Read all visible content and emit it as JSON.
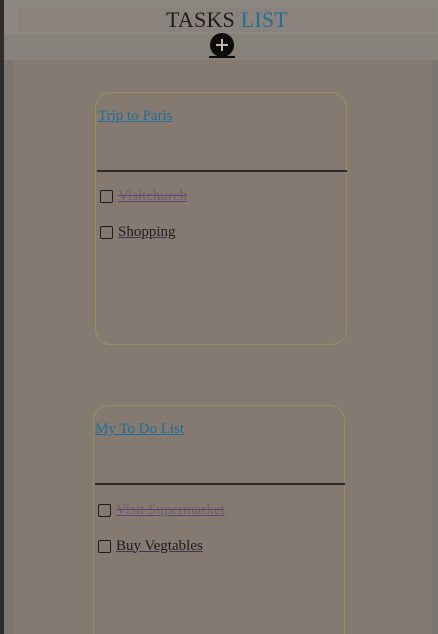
{
  "app": {
    "title_main": "TASKS",
    "title_accent": "LIST"
  },
  "toolbar": {
    "add_icon": "plus-circle-icon"
  },
  "lists": [
    {
      "title": "Trip to Paris",
      "tasks": [
        {
          "label": "Visitchurch",
          "done": true
        },
        {
          "label": "Shopping",
          "done": false
        }
      ]
    },
    {
      "title": "My To Do List",
      "tasks": [
        {
          "label": "Visit Supermarket",
          "done": true
        },
        {
          "label": "Buy Vegtables",
          "done": false
        }
      ]
    }
  ],
  "colors": {
    "accent": "#1f6f97",
    "background": "#847a72",
    "card_border": "#9b8d5a"
  }
}
